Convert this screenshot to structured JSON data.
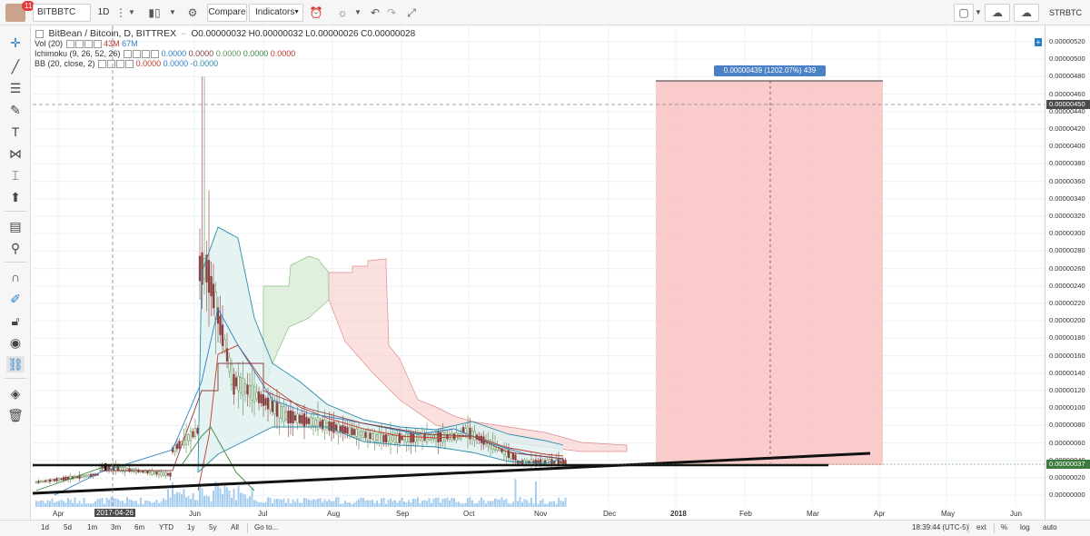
{
  "toolbar": {
    "avatar_badge": "11",
    "symbol": "BITBBTC",
    "interval": "1D",
    "compare_label": "Compare",
    "indicators_label": "Indicators",
    "right_symbol": "STRBTC"
  },
  "legend": {
    "title": "BitBean / Bitcoin, D, BITTREX",
    "o": "O0.00000032",
    "h": "H0.00000032",
    "l": "L0.00000026",
    "c": "C0.00000028",
    "vol_label": "Vol (20)",
    "vol_v1": "43M",
    "vol_v2": "67M",
    "ichimoku_label": "Ichimoku (9, 26, 52, 26)",
    "ichi_values": [
      "0.0000",
      "0.0000",
      "0.0000",
      "0.0000",
      "0.0000"
    ],
    "bb_label": "BB (20, close, 2)",
    "bb_values": [
      "0.0000",
      "0.0000",
      "-0.0000"
    ]
  },
  "measure_label": "0.00000439 (1202.07%) 439",
  "price_axis": {
    "ticks": [
      "0.00000520",
      "0.00000500",
      "0.00000480",
      "0.00000460",
      "0.00000440",
      "0.00000420",
      "0.00000400",
      "0.00000380",
      "0.00000360",
      "0.00000340",
      "0.00000320",
      "0.00000300",
      "0.00000280",
      "0.00000260",
      "0.00000240",
      "0.00000220",
      "0.00000200",
      "0.00000180",
      "0.00000160",
      "0.00000140",
      "0.00000120",
      "0.00000100",
      "0.00000080",
      "0.00000060",
      "0.00000040",
      "0.00000020",
      "0.00000000"
    ],
    "crosshair_price": "0.00000450",
    "last_price": "0.00000037"
  },
  "time_axis": {
    "labels": [
      "Apr",
      "Jun",
      "Jul",
      "Aug",
      "Sep",
      "Oct",
      "Nov",
      "Dec",
      "2018",
      "Feb",
      "Mar",
      "Apr",
      "May",
      "Jun"
    ],
    "crosshair_date": "2017-04-26"
  },
  "bottom_bar": {
    "ranges": [
      "1d",
      "5d",
      "1m",
      "3m",
      "6m",
      "YTD",
      "1y",
      "5y",
      "All"
    ],
    "goto": "Go to...",
    "clock": "18:39:44 (UTC-5)",
    "ext": "ext",
    "pct": "%",
    "log": "log",
    "auto": "auto"
  },
  "colors": {
    "candle_up": "#5a8a4e",
    "candle_down": "#8a3c3c",
    "cloud_red": "#f7c6c6",
    "cloud_green": "#d9ecd6",
    "bb_fill": "#dff0f0",
    "measure_fill": "#f9c2c2",
    "accent": "#2a7fc6"
  }
}
